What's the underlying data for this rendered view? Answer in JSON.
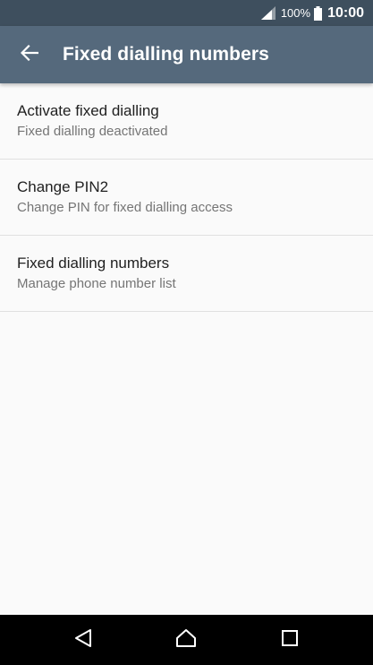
{
  "status_bar": {
    "battery_percent": "100%",
    "time": "10:00",
    "icons": [
      "signal-icon",
      "battery-icon"
    ]
  },
  "app_bar": {
    "title": "Fixed dialling numbers",
    "back_icon": "arrow-back-icon"
  },
  "list": {
    "items": [
      {
        "title": "Activate fixed dialling",
        "subtitle": "Fixed dialling deactivated"
      },
      {
        "title": "Change PIN2",
        "subtitle": "Change PIN for fixed dialling access"
      },
      {
        "title": "Fixed dialling numbers",
        "subtitle": "Manage phone number list"
      }
    ]
  },
  "nav_bar": {
    "icons": [
      "nav-back-icon",
      "nav-home-icon",
      "nav-recents-icon"
    ]
  },
  "colors": {
    "status_bar": "#3e4f5e",
    "app_bar": "#55697c",
    "background": "#fafafa"
  }
}
